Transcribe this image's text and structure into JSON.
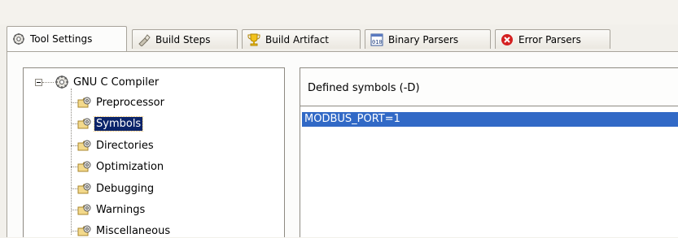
{
  "tabs": [
    {
      "label": "Tool Settings",
      "icon": "tool-settings-gear-icon",
      "active": true
    },
    {
      "label": "Build Steps",
      "icon": "build-steps-icon",
      "active": false
    },
    {
      "label": "Build Artifact",
      "icon": "build-artifact-trophy-icon",
      "active": false
    },
    {
      "label": "Binary Parsers",
      "icon": "binary-parsers-icon",
      "active": false
    },
    {
      "label": "Error Parsers",
      "icon": "error-parsers-icon",
      "active": false
    }
  ],
  "tree": {
    "root": {
      "label": "GNU C Compiler",
      "icon": "compiler-gear-icon",
      "expanded": true
    },
    "items": [
      {
        "label": "Preprocessor",
        "icon": "folder-gear-icon"
      },
      {
        "label": "Symbols",
        "icon": "folder-gear-icon",
        "selected": true
      },
      {
        "label": "Directories",
        "icon": "folder-gear-icon"
      },
      {
        "label": "Optimization",
        "icon": "folder-gear-icon"
      },
      {
        "label": "Debugging",
        "icon": "folder-gear-icon"
      },
      {
        "label": "Warnings",
        "icon": "folder-gear-icon"
      },
      {
        "label": "Miscellaneous",
        "icon": "folder-gear-icon"
      }
    ]
  },
  "symbols_panel": {
    "header": "Defined symbols (-D)",
    "entries": [
      "MODBUS_PORT=1"
    ]
  },
  "colors": {
    "selection": "#3169c6",
    "tree_selection": "#0b246a",
    "error_icon": "#d42020"
  }
}
